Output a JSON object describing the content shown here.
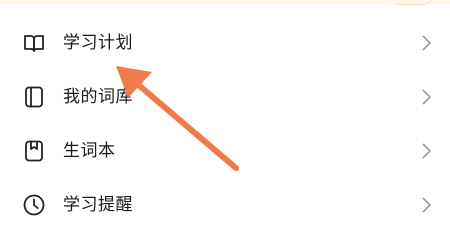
{
  "menu": {
    "items": [
      {
        "label": "学习计划",
        "icon": "book-open-icon"
      },
      {
        "label": "我的词库",
        "icon": "notebook-icon"
      },
      {
        "label": "生词本",
        "icon": "bookmark-book-icon"
      },
      {
        "label": "学习提醒",
        "icon": "clock-icon"
      }
    ]
  },
  "annotation": {
    "color": "#f07a4a",
    "points_to": "学习计划"
  }
}
